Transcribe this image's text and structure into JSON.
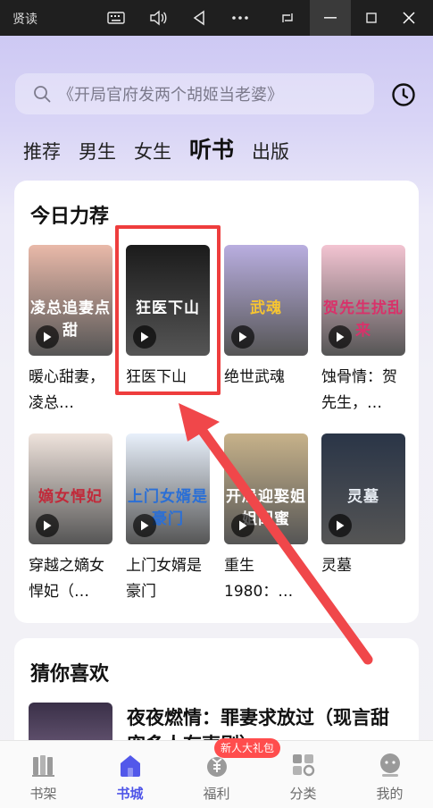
{
  "window": {
    "app_title": "贤读",
    "icons": [
      "keyboard-icon",
      "volume-icon",
      "back-triangle-icon",
      "more-icon",
      "screenshot-icon",
      "minimize-icon",
      "maximize-icon",
      "close-icon"
    ]
  },
  "search": {
    "placeholder": "《开局官府发两个胡姬当老婆》"
  },
  "categories": [
    "推荐",
    "男生",
    "女生",
    "听书",
    "出版"
  ],
  "active_category": "听书",
  "today": {
    "title": "今日力荐",
    "books": [
      {
        "name": "暖心甜妻，凌总…",
        "cover_text": "凌总追妻点甜",
        "cover_color": "#e9b9a9",
        "cover_text_color": "#ffffff"
      },
      {
        "name": "狂医下山",
        "cover_text": "狂医下山",
        "cover_color": "#1b1b1b",
        "cover_text_color": "#ffffff"
      },
      {
        "name": "绝世武魂",
        "cover_text": "武魂",
        "cover_color": "#b9aee0",
        "cover_text_color": "#f7c531"
      },
      {
        "name": "蚀骨情：贺先生，…",
        "cover_text": "贺先生扰乱来",
        "cover_color": "#f3c4d2",
        "cover_text_color": "#d8326a"
      },
      {
        "name": "穿越之嫡女悍妃（…",
        "cover_text": "嫡女悍妃",
        "cover_color": "#efe3dc",
        "cover_text_color": "#c12a3a"
      },
      {
        "name": "上门女婿是豪门",
        "cover_text": "上门女婿是豪门",
        "cover_color": "#e8f0fb",
        "cover_text_color": "#2a6fd6"
      },
      {
        "name": "重生1980：…",
        "cover_text": "开局迎娶姐姐闺蜜",
        "cover_color": "#c7b28a",
        "cover_text_color": "#ffffff"
      },
      {
        "name": "灵墓",
        "cover_text": "灵墓",
        "cover_color": "#2a3547",
        "cover_text_color": "#e8edf4"
      }
    ]
  },
  "guess": {
    "title": "猜你喜欢",
    "book_title": "夜夜燃情：罪妻求放过（现言甜宠多人有声剧）"
  },
  "nav": [
    {
      "label": "书架",
      "icon": "bookshelf-icon"
    },
    {
      "label": "书城",
      "icon": "bookstore-icon"
    },
    {
      "label": "福利",
      "icon": "welfare-icon"
    },
    {
      "label": "分类",
      "icon": "category-icon"
    },
    {
      "label": "我的",
      "icon": "profile-icon"
    }
  ],
  "active_nav": "书城",
  "gift_badge": "新人大礼包",
  "colors": {
    "accent": "#4f55e8",
    "highlight_red": "#ee3d3d",
    "badge": "#ff4d4d"
  }
}
